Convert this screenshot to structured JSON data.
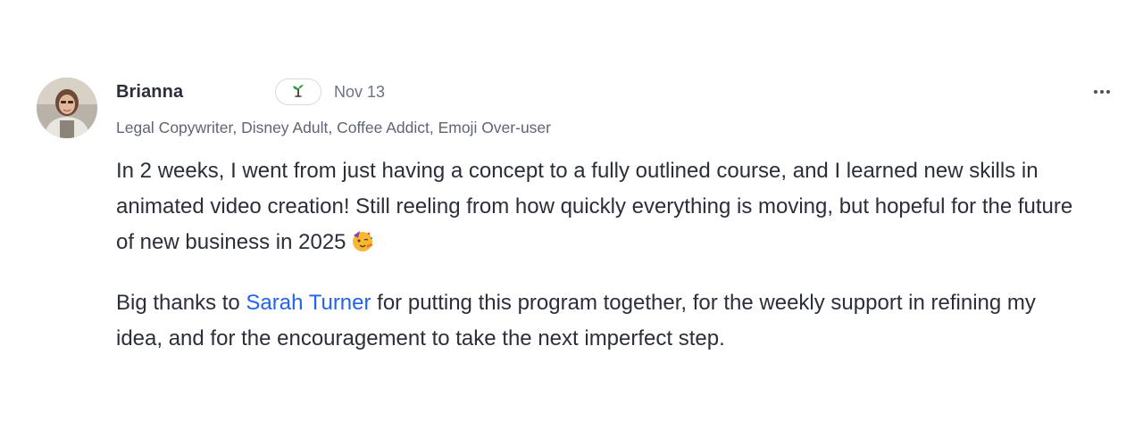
{
  "post": {
    "author": "Brianna",
    "badge_icon": "seedling-icon",
    "date": "Nov 13",
    "headline": "Legal Copywriter, Disney Adult, Coffee Addict, Emoji Over-user",
    "paragraph1": "In 2 weeks, I went from just having a concept to a fully outlined course, and I learned new skills in animated video creation! Still reeling from how quickly everything is moving, but hopeful for the future of new business in 2025",
    "paragraph1_emoji": "partying-face-emoji",
    "paragraph2_before": "Big thanks to ",
    "mention": "Sarah Turner",
    "paragraph2_after": " for putting this program together, for the weekly support in refining my idea, and for the encouragement to take the next imperfect step.",
    "more_icon": "more-horizontal-icon"
  },
  "colors": {
    "text": "#2b2f3a",
    "muted": "#6b7280",
    "mention": "#2563eb",
    "badge_border": "#d7dae0",
    "seedling": "#2f9e44"
  }
}
